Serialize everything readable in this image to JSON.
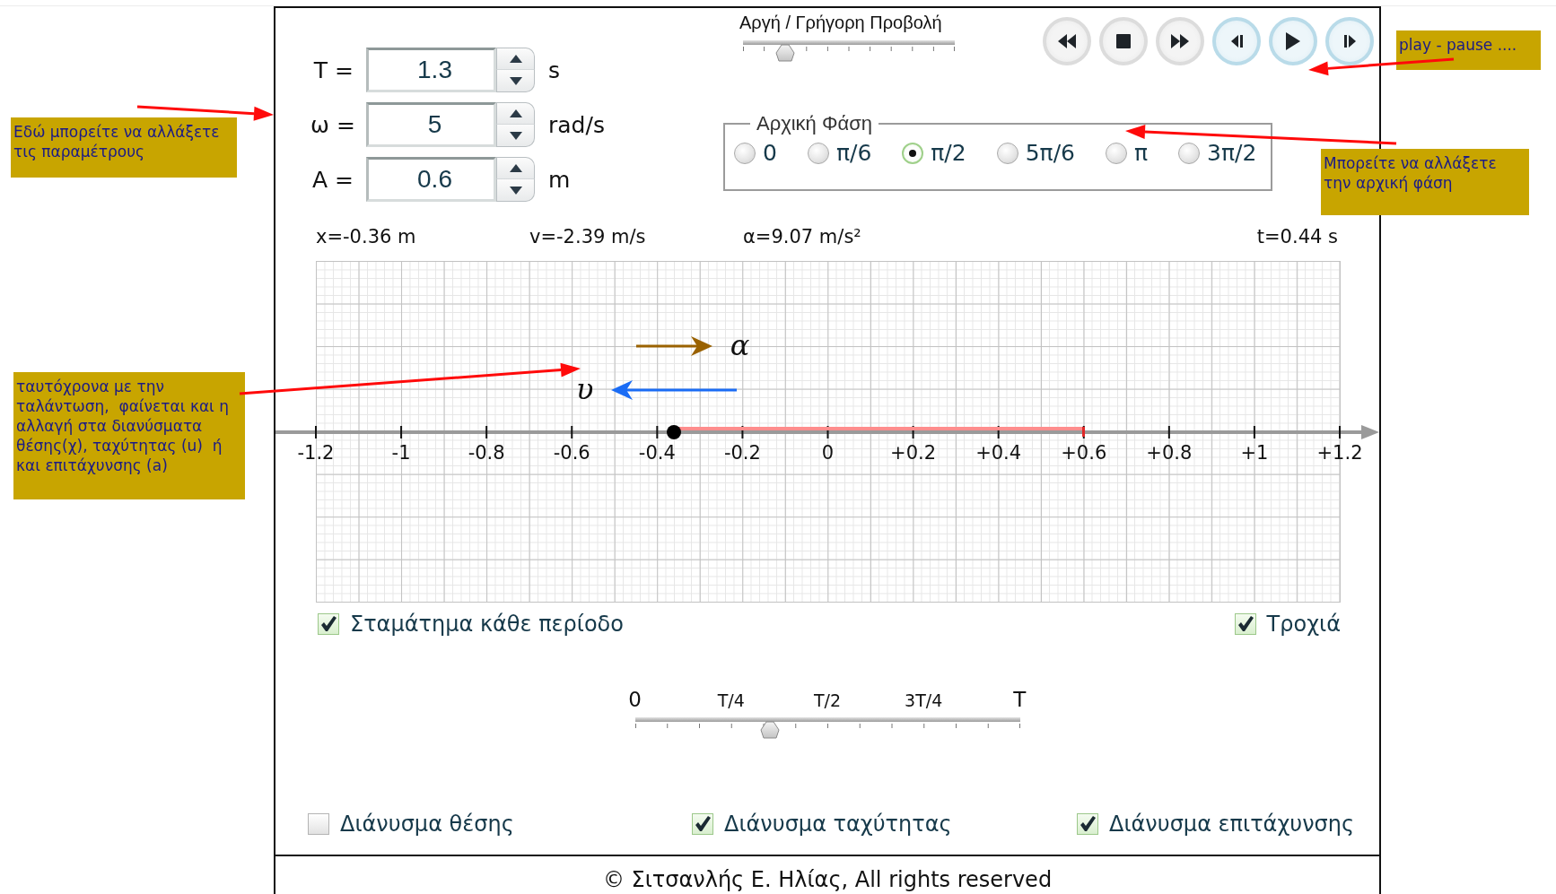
{
  "annotations": [
    "Εδώ μπορείτε να αλλάξετε τις παραμέτρους",
    "play - pause ....",
    "Μπορείτε να αλλάξετε την αρχική φάση",
    "ταυτόχρονα με την ταλάντωση,  φαίνεται και η αλλαγή στα διανύσματα θέσης(χ), ταχύτητας (u)  ή και επιτάχυνσης (a)"
  ],
  "parameters": [
    {
      "label": "T =",
      "value": "1.3",
      "unit": "s"
    },
    {
      "label": "ω =",
      "value": "5",
      "unit": "rad/s"
    },
    {
      "label": "A =",
      "value": "0.6",
      "unit": "m"
    }
  ],
  "speed_slider": {
    "label": "Αργή / Γρήγορη Προβολή",
    "level": 0.2
  },
  "playback_buttons": [
    {
      "kind": "rewind",
      "highlighted": false
    },
    {
      "kind": "stop",
      "highlighted": false
    },
    {
      "kind": "fast_forward",
      "highlighted": false
    },
    {
      "kind": "step_back",
      "highlighted": true
    },
    {
      "kind": "play",
      "highlighted": true
    },
    {
      "kind": "step_forward",
      "highlighted": true
    }
  ],
  "initial_phase": {
    "title": "Αρχική Φάση",
    "options": [
      {
        "label": "0",
        "selected": false
      },
      {
        "label": "π/6",
        "selected": false
      },
      {
        "label": "π/2",
        "selected": true
      },
      {
        "label": "5π/6",
        "selected": false
      },
      {
        "label": "π",
        "selected": false
      },
      {
        "label": "3π/2",
        "selected": false
      }
    ]
  },
  "readouts": {
    "position": "x=-0.36 m",
    "velocity": "v=-2.39 m/s",
    "acceleration": "α=9.07 m/s²",
    "time": "t=0.44 s"
  },
  "number_line": {
    "tick_labels": [
      "-1.2",
      "-1",
      "-0.8",
      "-0.6",
      "-0.4",
      "-0.2",
      "0",
      "+0.2",
      "+0.4",
      "+0.6",
      "+0.8",
      "+1",
      "+1.2"
    ],
    "particle": {
      "level": 0.35
    },
    "trajectory": {
      "level": 0.75
    },
    "vectors": [
      {
        "kind": "acceleration",
        "symbol": "α",
        "color": "#9a6200",
        "points_left": false
      },
      {
        "kind": "velocity",
        "symbol": "υ",
        "color": "#1a6cf5",
        "points_left": true
      }
    ]
  },
  "options": [
    {
      "label": "Σταμάτημα κάθε περίοδο",
      "checked": true
    },
    {
      "label": "Τροχιά",
      "checked": true
    }
  ],
  "time_slider": {
    "marks": [
      "0",
      "T/4",
      "T/2",
      "3T/4",
      "T"
    ],
    "level": 0.35
  },
  "vector_options": [
    {
      "label": "Διάνυσμα θέσης",
      "checked": false
    },
    {
      "label": "Διάνυσμα ταχύτητας",
      "checked": true
    },
    {
      "label": "Διάνυσμα επιτάχυνσης",
      "checked": true
    }
  ],
  "footer": "© Σιτσανλής Ε. Ηλίας, All rights reserved"
}
